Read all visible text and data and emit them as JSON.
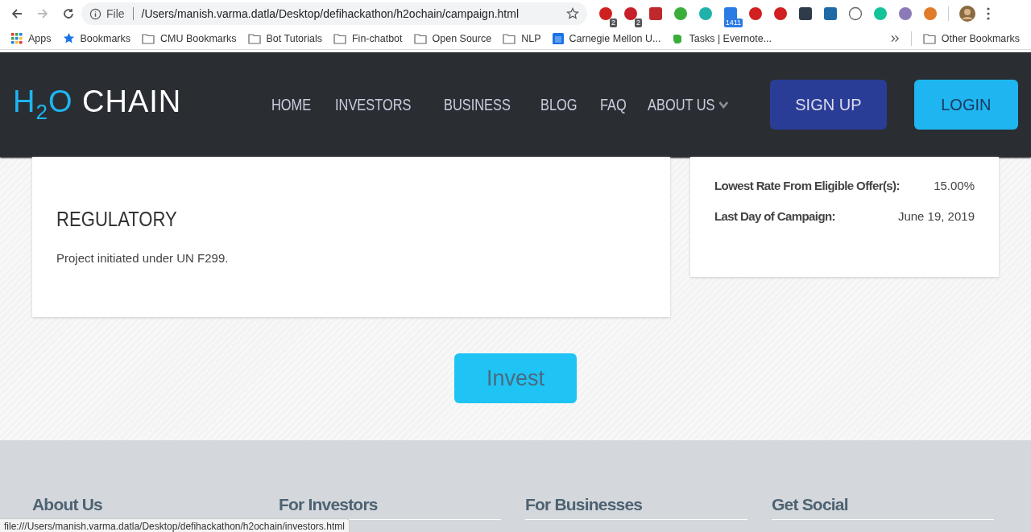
{
  "browser": {
    "scheme": "File",
    "url": "/Users/manish.varma.datla/Desktop/defihackathon/h2ochain/campaign.html",
    "extensions": [
      {
        "kind": "circle",
        "color": "#d0201f",
        "badge": "2"
      },
      {
        "kind": "circle",
        "color": "#c8202a",
        "badge": "2"
      },
      {
        "kind": "square",
        "color": "#c0282c"
      },
      {
        "kind": "circle",
        "color": "#3aae3a"
      },
      {
        "kind": "circle",
        "color": "#20b2aa"
      },
      {
        "kind": "square",
        "color": "#2a7be4",
        "badge": "1411"
      },
      {
        "kind": "circle",
        "color": "#d0201f"
      },
      {
        "kind": "circle",
        "color": "#d0201f"
      },
      {
        "kind": "square",
        "color": "#2f3b48"
      },
      {
        "kind": "square",
        "color": "#1f6aa5"
      },
      {
        "kind": "ring",
        "color": "#666666"
      },
      {
        "kind": "circle",
        "color": "#15c39a"
      },
      {
        "kind": "circle",
        "color": "#8a7bb8"
      },
      {
        "kind": "circle",
        "color": "#e07b27"
      }
    ],
    "bookmarks": [
      {
        "kind": "apps",
        "label": "Apps"
      },
      {
        "kind": "star",
        "label": "Bookmarks"
      },
      {
        "kind": "folder",
        "label": "CMU Bookmarks"
      },
      {
        "kind": "folder",
        "label": "Bot Tutorials"
      },
      {
        "kind": "folder",
        "label": "Fin-chatbot"
      },
      {
        "kind": "folder",
        "label": "Open Source"
      },
      {
        "kind": "folder",
        "label": "NLP"
      },
      {
        "kind": "calendar",
        "label": "Carnegie Mellon U..."
      },
      {
        "kind": "evernote",
        "label": "Tasks | Evernote..."
      }
    ],
    "other_bookmarks": "Other Bookmarks",
    "status_url": "file:///Users/manish.varma.datla/Desktop/defihackathon/h2ochain/investors.html"
  },
  "site": {
    "logo": {
      "h": "H",
      "sub": "2",
      "o": "O",
      "name": "CHAIN"
    },
    "nav": [
      {
        "label": "HOME",
        "dropdown": false
      },
      {
        "label": "INVESTORS",
        "dropdown": false
      },
      {
        "label": "BUSINESS",
        "dropdown": false
      },
      {
        "label": "BLOG",
        "dropdown": false
      },
      {
        "label": "FAQ",
        "dropdown": false
      },
      {
        "label": "ABOUT US",
        "dropdown": true
      }
    ],
    "signup": "SIGN UP",
    "login": "LOGIN"
  },
  "details": {
    "heading": "REGULATORY",
    "text": "Project initiated under UN F299."
  },
  "summary": [
    {
      "label": "Lowest Rate From Eligible Offer(s):",
      "value": "15.00%"
    },
    {
      "label": "Last Day of Campaign:",
      "value": "June 19, 2019"
    }
  ],
  "invest": "Invest",
  "footer": [
    "About Us",
    "For Investors",
    "For Businesses",
    "Get Social"
  ]
}
